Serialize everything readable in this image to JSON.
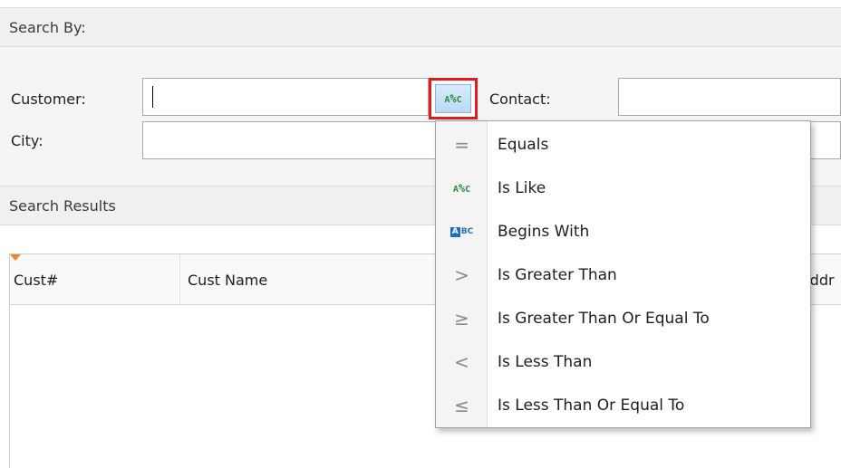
{
  "search_by": {
    "header": "Search By:",
    "customer_label": "Customer:",
    "customer_value": "",
    "contact_label": "Contact:",
    "contact_value": "",
    "city_label": "City:",
    "city_value": "",
    "operator_button_icon": "is-like-icon"
  },
  "search_results": {
    "header": "Search Results",
    "columns": [
      "Cust#",
      "Cust Name",
      "Addr"
    ]
  },
  "operator_menu": {
    "items": [
      {
        "icon": "equals-icon",
        "glyph": "=",
        "label": "Equals"
      },
      {
        "icon": "is-like-icon",
        "glyph": "",
        "label": "Is Like"
      },
      {
        "icon": "begins-with-icon",
        "glyph": "",
        "label": "Begins With"
      },
      {
        "icon": "greater-than-icon",
        "glyph": ">",
        "label": "Is Greater Than"
      },
      {
        "icon": "greater-equal-icon",
        "glyph": "≥",
        "label": "Is Greater Than Or Equal To"
      },
      {
        "icon": "less-than-icon",
        "glyph": "<",
        "label": "Is Less Than"
      },
      {
        "icon": "less-equal-icon",
        "glyph": "≤",
        "label": "Is Less Than Or Equal To"
      }
    ]
  },
  "colors": {
    "highlight_border": "#e31b1b",
    "like_green": "#2d8a3e",
    "begins_blue": "#1f6fc5",
    "sort_arrow": "#f0882a"
  }
}
